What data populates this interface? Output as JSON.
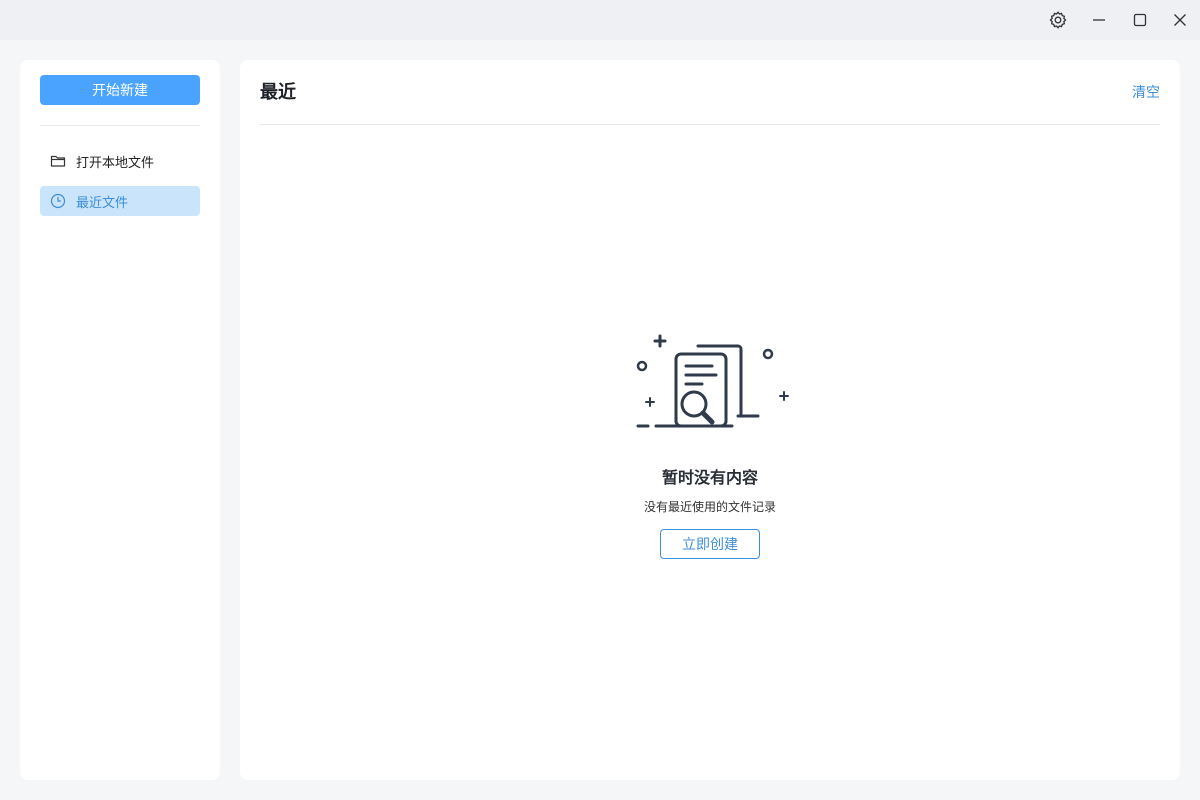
{
  "sidebar": {
    "new_button_label": "开始新建",
    "items": [
      {
        "label": "打开本地文件",
        "icon": "folder-icon"
      },
      {
        "label": "最近文件",
        "icon": "clock-icon"
      }
    ]
  },
  "main": {
    "title": "最近",
    "clear_label": "清空",
    "empty": {
      "title": "暂时没有内容",
      "description": "没有最近使用的文件记录",
      "create_label": "立即创建"
    }
  },
  "colors": {
    "accent": "#4aa3ff",
    "link": "#3b8ed8",
    "active_item_bg": "#c9e4fb"
  }
}
